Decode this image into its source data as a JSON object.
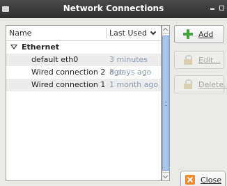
{
  "window": {
    "title": "Network Connections"
  },
  "list": {
    "columns": {
      "name": "Name",
      "last_used": "Last Used"
    },
    "group": {
      "label": "Ethernet"
    },
    "rows": [
      {
        "name": "default eth0",
        "last_used": "3 minutes ago"
      },
      {
        "name": "Wired connection 2",
        "last_used": "8 days ago"
      },
      {
        "name": "Wired connection 1",
        "last_used": "1 month ago"
      }
    ]
  },
  "buttons": {
    "add": "Add",
    "edit": "Edit...",
    "delete": "Delete...",
    "close": "Close"
  }
}
